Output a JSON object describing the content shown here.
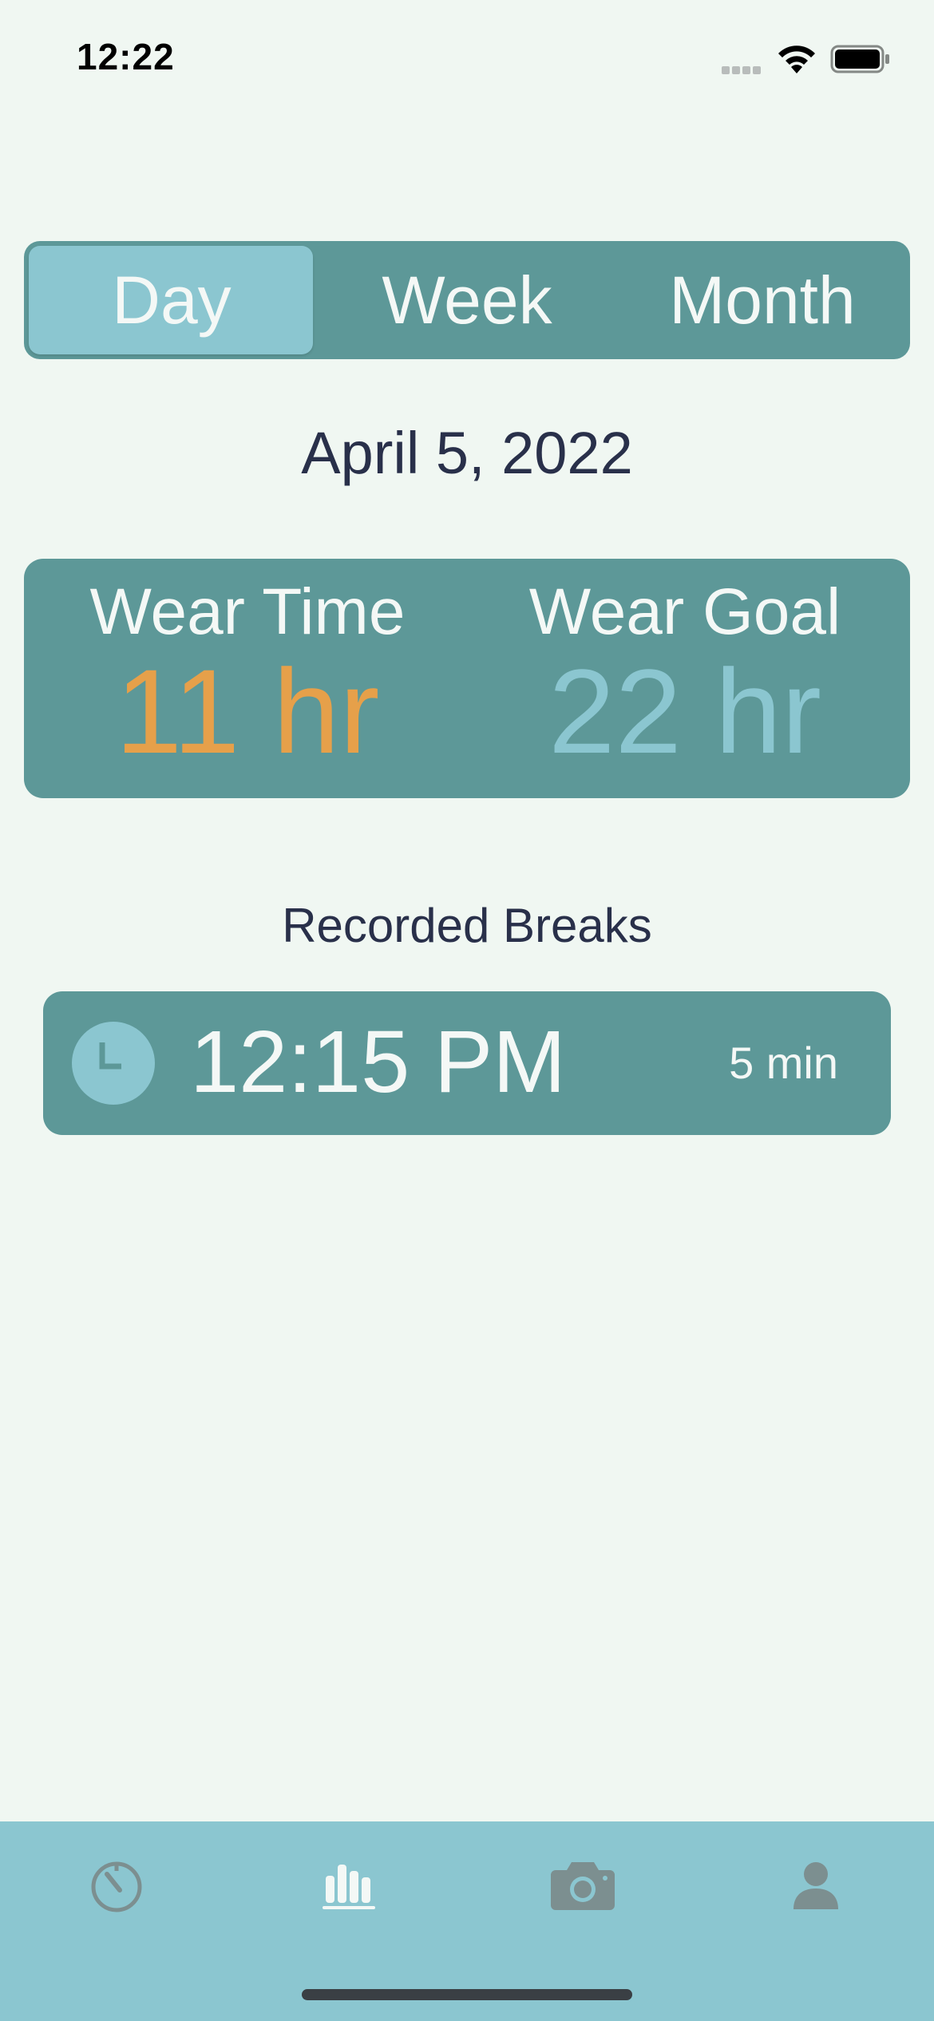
{
  "status_bar": {
    "time": "12:22"
  },
  "segmented_control": {
    "segments": [
      "Day",
      "Week",
      "Month"
    ],
    "selected": "Day"
  },
  "date": "April 5, 2022",
  "stats": {
    "wear_time_label": "Wear Time",
    "wear_time_value": "11 hr",
    "wear_goal_label": "Wear Goal",
    "wear_goal_value": "22 hr"
  },
  "breaks": {
    "title": "Recorded Breaks",
    "items": [
      {
        "time": "12:15 PM",
        "duration": "5 min",
        "icon": "clock-icon"
      }
    ]
  },
  "tab_bar": {
    "tabs": [
      {
        "icon": "timer-icon",
        "active": false
      },
      {
        "icon": "stats-icon",
        "active": true
      },
      {
        "icon": "camera-icon",
        "active": false
      },
      {
        "icon": "profile-icon",
        "active": false
      }
    ]
  },
  "colors": {
    "background": "#f0f7f2",
    "card": "#5d9898",
    "accent_light": "#8bc6d0",
    "wear_time": "#e6a04a",
    "text_dark": "#29304a",
    "icon_inactive": "#7c8f90",
    "icon_active": "#f4f8f6"
  }
}
